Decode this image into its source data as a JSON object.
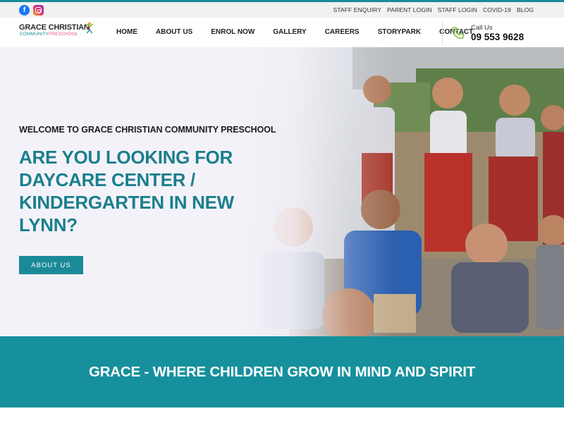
{
  "colors": {
    "brand_teal": "#1b8a98",
    "headline_teal": "#1b7f8c",
    "band_teal": "#16909c",
    "facebook_blue": "#1877f2",
    "instagram_pink": "#e1306c",
    "logo_pink": "#e84e8a",
    "phone_green": "#7cc242"
  },
  "topbar": {
    "social": [
      {
        "name": "facebook",
        "icon": "facebook-icon"
      },
      {
        "name": "instagram",
        "icon": "instagram-icon"
      }
    ],
    "links": [
      "STAFF ENQUIRY",
      "PARENT LOGIN",
      "STAFF LOGIN",
      "COVID-19",
      "BLOG"
    ]
  },
  "logo": {
    "line1": "GRACE CHRISTIAN",
    "line2a": "COMMUNITY",
    "line2b": "PRESCHOOL",
    "icon": "child-figure-icon"
  },
  "nav": [
    "HOME",
    "ABOUT US",
    "ENROL NOW",
    "GALLERY",
    "CAREERS",
    "STORYPARK",
    "CONTACT"
  ],
  "call": {
    "label": "Call Us",
    "number": "09 553 9628",
    "icon": "phone-icon"
  },
  "hero": {
    "welcome": "WELCOME TO GRACE CHRISTIAN COMMUNITY PRESCHOOL",
    "headline": "ARE YOU LOOKING FOR DAYCARE CENTER / KINDERGARTEN IN NEW LYNN?",
    "button": "ABOUT US",
    "image": "children-group-photo"
  },
  "tagline": "GRACE - WHERE CHILDREN GROW IN MIND AND SPIRIT"
}
